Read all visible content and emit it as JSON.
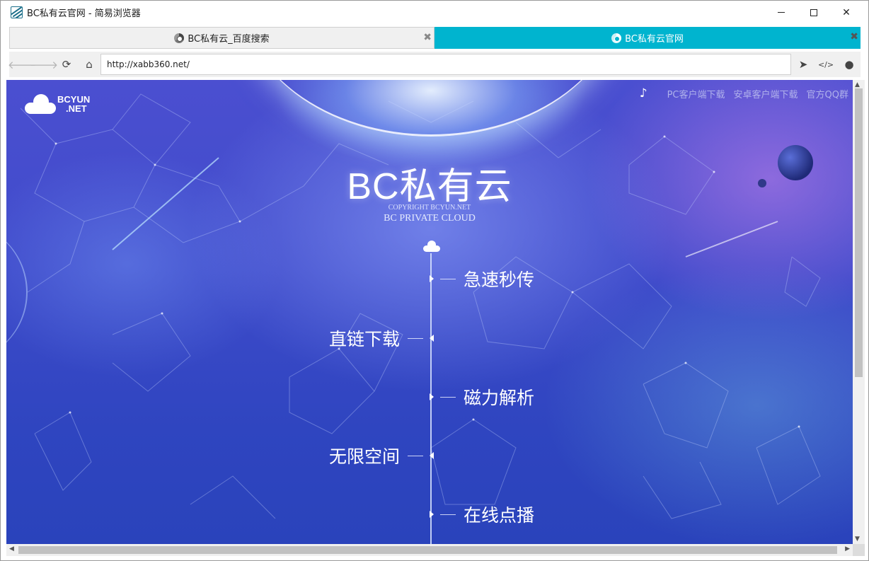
{
  "window": {
    "title": "BC私有云官网 - 简易浏览器",
    "minimize_icon": "minimize-icon",
    "maximize_icon": "maximize-icon",
    "close_icon": "close-icon"
  },
  "tabs": [
    {
      "label": "BC私有云_百度搜索",
      "active": false,
      "close": "✖"
    },
    {
      "label": "BC私有云官网",
      "active": true,
      "close": "✖"
    }
  ],
  "toolbar": {
    "back_icon": "back-arrow-icon",
    "forward_icon": "forward-arrow-icon",
    "reload_icon": "reload-icon",
    "home_icon": "home-icon",
    "url": "http://xabb360.net/",
    "go_icon": "navigate-icon",
    "source_icon": "view-source-icon",
    "qq_icon": "qq-penguin-icon"
  },
  "page": {
    "logo": {
      "line1": "BCYUN",
      "line2": ".NET"
    },
    "topnav": {
      "links": [
        "PC客户端下载",
        "安卓客户端下载",
        "官方QQ群"
      ]
    },
    "brand_title": "BC私有云",
    "copyright": "COPYRIGHT BCYUN.NET",
    "subtitle": "BC PRIVATE CLOUD",
    "features": [
      {
        "label": "急速秒传",
        "side": "right"
      },
      {
        "label": "直链下载",
        "side": "left"
      },
      {
        "label": "磁力解析",
        "side": "right"
      },
      {
        "label": "无限空间",
        "side": "left"
      },
      {
        "label": "在线点播",
        "side": "right"
      }
    ]
  },
  "colors": {
    "active_tab": "#00b4cf",
    "background_top": "#4b4fd0",
    "background_bottom": "#2a43bb"
  }
}
